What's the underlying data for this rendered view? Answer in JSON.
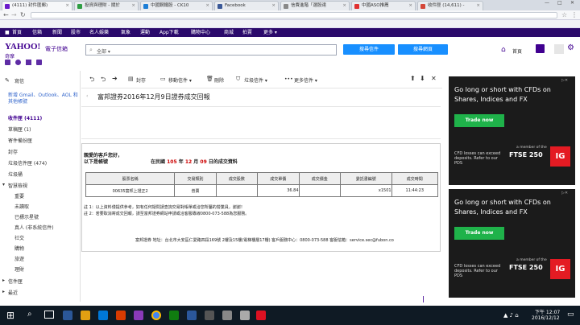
{
  "browser": {
    "tabs": [
      {
        "label": "(4111) 封件匯郵)",
        "color": "#6a1bcb",
        "active": true
      },
      {
        "label": "投資與理財 - 關於",
        "color": "#2f9e44"
      },
      {
        "label": "中國鋼鐵股 - CK10",
        "color": "#1c7ed6"
      },
      {
        "label": "Facebook",
        "color": "#3b5998"
      },
      {
        "label": "信費進階「選股達",
        "color": "#888888"
      },
      {
        "label": "中國ASO推薦",
        "color": "#e03131"
      },
      {
        "label": "收件匣 (14,611) -",
        "color": "#d44638"
      }
    ],
    "url": "",
    "win_min": "—",
    "win_max": "□",
    "win_close": "✕"
  },
  "yahoo_nav": {
    "items": [
      "首頁",
      "信箱",
      "新聞",
      "股市",
      "名人娛樂",
      "氣象",
      "運動",
      "App下載",
      "購物中心",
      "商城",
      "拍賣",
      "更多 ▾"
    ]
  },
  "header": {
    "logo_top": "YAHOO!",
    "logo_mid": "電子信箱",
    "logo_sub": "奇摩",
    "search_scope": "全部 ▾",
    "search_placeholder": "",
    "search_mail": "搜尋信件",
    "search_web": "搜尋網頁",
    "home": "首頁"
  },
  "sidebar": {
    "compose": "寫信",
    "add_accounts": "新增 Gmail、Outlook、AOL 和其他帳號",
    "folders": [
      "收件匣 (4111)",
      "草稿匣 (1)",
      "寄件備份匣",
      "封存",
      "垃圾信件匣 (474)",
      "垃圾桶"
    ],
    "smart_views_label": "智慧檢視",
    "smart": [
      "重要",
      "未讀取",
      "已標示星號",
      "真人 (非系統信件)",
      "社交",
      "購物",
      "旅遊",
      "理財"
    ],
    "folders_label": "信件匣",
    "recent_label": "最近"
  },
  "toolbar": {
    "archive": "封存",
    "move": "移動信件 ▾",
    "delete": "刪除",
    "spam": "垃圾信件 ▾",
    "more": "更多信件 ▾"
  },
  "message": {
    "subject": "富邦證券2016年12月9日證券成交回報",
    "greeting": "親愛的客戶您好，",
    "account_label": "以下是帳號",
    "report_prefix": "在民國",
    "report_year": "105",
    "report_year_unit": "年",
    "report_month": "12",
    "report_month_unit": "月",
    "report_day": "09",
    "report_suffix": "日的成交資料",
    "table_headers": [
      "股票名稱",
      "交易類別",
      "成交股數",
      "成交單價",
      "成交價金",
      "委託書編號",
      "成交時間"
    ],
    "table_rows": [
      [
        "00635富邦上證正2",
        "普賣",
        "",
        "36.84",
        "",
        "x1501",
        "11:44:23"
      ]
    ],
    "note1": "註 1：以上資料僅提供參考，如有任何疑問請查詢交易對帳單或洽您所屬的營業員，謝謝！",
    "note2": "註 2：若要取消寄成交回報，請至富邦證券網站申請或洽客服專線0800-073-588為您服務。",
    "footer": "富邦證券 地址：台北市大安區仁愛路四段169號 2樓及15樓(電梯樓層17樓) 客戶服務中心：0800-073-588 客服信箱：service.sec@fubon.co"
  },
  "ads": [
    {
      "headline": "Go long or short with CFDs on Shares, Indices and FX",
      "cta": "Trade now",
      "disclaimer": "CFD losses can exceed deposits. Refer to our PDS",
      "member": "a member of the",
      "index": "FTSE 250",
      "brand": "IG"
    },
    {
      "headline": "Go long or short with CFDs on Shares, Indices and FX",
      "cta": "Trade now",
      "disclaimer": "CFD losses can exceed deposits. Refer to our PDS",
      "member": "a member of the",
      "index": "FTSE 250",
      "brand": "IG"
    }
  ],
  "taskbar": {
    "time": "下午 12:07",
    "date": "2016/12/12"
  }
}
